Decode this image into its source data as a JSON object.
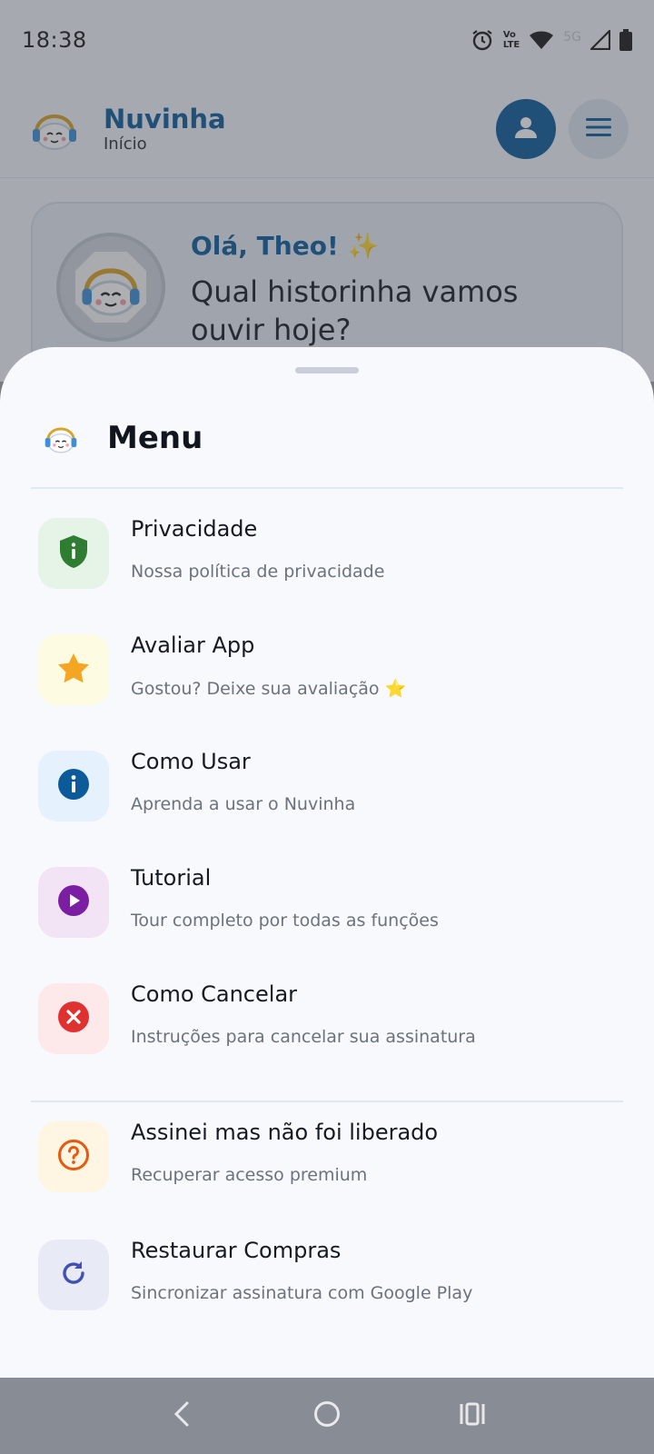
{
  "status_bar": {
    "time": "18:38",
    "icons": [
      "alarm-icon",
      "volte-icon",
      "wifi-icon",
      "5g-icon",
      "signal-icon",
      "battery-icon"
    ],
    "volte_label_top": "Vo",
    "volte_label_bottom": "LTE",
    "network_label": "5G"
  },
  "appbar": {
    "title": "Nuvinha",
    "subtitle": "Início"
  },
  "greeting": {
    "hello": "Olá, Theo! ✨",
    "question": "Qual historinha vamos ouvir hoje?"
  },
  "menu": {
    "title": "Menu",
    "items": [
      {
        "title": "Privacidade",
        "subtitle": "Nossa política de privacidade",
        "icon": "shield-info-icon",
        "bg": "#e6f4e8",
        "fg": "#2e7d32"
      },
      {
        "title": "Avaliar App",
        "subtitle": "Gostou? Deixe sua avaliação ⭐",
        "icon": "star-icon",
        "bg": "#fefbe3",
        "fg": "#f4a623"
      },
      {
        "title": "Como Usar",
        "subtitle": "Aprenda a usar o Nuvinha",
        "icon": "info-icon",
        "bg": "#e5f1fc",
        "fg": "#0d5a9a"
      },
      {
        "title": "Tutorial",
        "subtitle": "Tour completo por todas as funções",
        "icon": "play-icon",
        "bg": "#f3e4f5",
        "fg": "#7b1fa2"
      },
      {
        "title": "Como Cancelar",
        "subtitle": "Instruções para cancelar sua assinatura",
        "icon": "cancel-icon",
        "bg": "#fde8ea",
        "fg": "#e03131"
      }
    ],
    "extra_items": [
      {
        "title": "Assinei mas não foi liberado",
        "subtitle": "Recuperar acesso premium",
        "icon": "help-icon",
        "bg": "#fef6e2",
        "fg": "#e8590c"
      },
      {
        "title": "Restaurar Compras",
        "subtitle": "Sincronizar assinatura com Google Play",
        "icon": "refresh-icon",
        "bg": "#e8ebf6",
        "fg": "#3f51b5"
      }
    ]
  },
  "navbar": {
    "buttons": [
      "back-icon",
      "home-icon",
      "recents-icon"
    ]
  }
}
